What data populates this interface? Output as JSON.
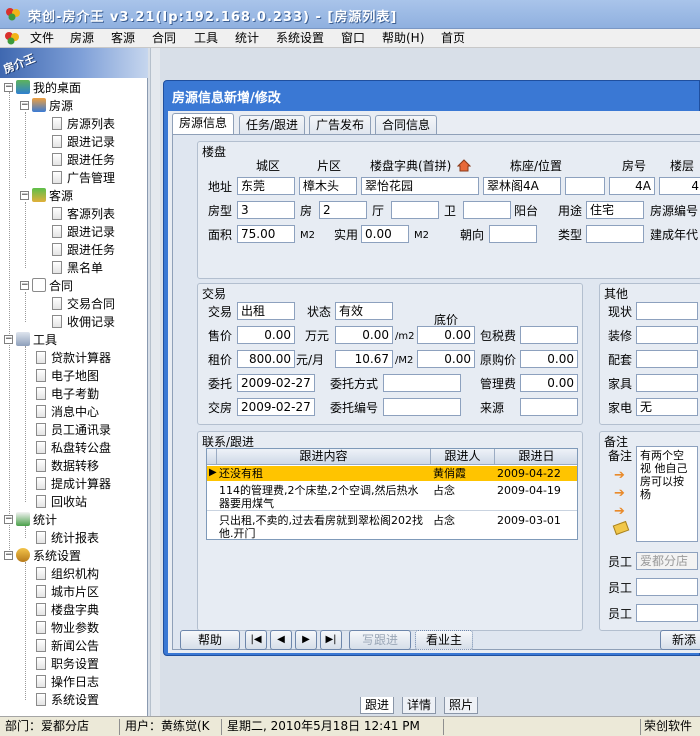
{
  "window": {
    "title": "荣创-房介王 v3.21(Ip:192.168.0.233) - [房源列表]"
  },
  "menu": [
    "文件",
    "房源",
    "客源",
    "合同",
    "工具",
    "统计",
    "系统设置",
    "窗口",
    "帮助(H)",
    "首页"
  ],
  "sidebar": {
    "banner": "房介王",
    "root": "我的桌面",
    "groups": [
      {
        "label": "房源",
        "items": [
          "房源列表",
          "跟进记录",
          "跟进任务",
          "广告管理"
        ]
      },
      {
        "label": "客源",
        "items": [
          "客源列表",
          "跟进记录",
          "跟进任务",
          "黑名单"
        ]
      },
      {
        "label": "合同",
        "items": [
          "交易合同",
          "收佣记录"
        ]
      },
      {
        "label": "工具",
        "items": [
          "贷款计算器",
          "电子地图",
          "电子考勤",
          "消息中心",
          "员工通讯录",
          "私盘转公盘",
          "数据转移",
          "提成计算器",
          "回收站"
        ]
      },
      {
        "label": "统计",
        "items": [
          "统计报表"
        ]
      },
      {
        "label": "系统设置",
        "items": [
          "组织机构",
          "城市片区",
          "楼盘字典",
          "物业参数",
          "新闻公告",
          "职务设置",
          "操作日志",
          "系统设置"
        ]
      }
    ]
  },
  "background_tabs": [
    "跟进",
    "详情",
    "照片"
  ],
  "dialog": {
    "title": "房源信息新增/修改",
    "tabs": [
      "房源信息",
      "任务/跟进",
      "广告发布",
      "合同信息"
    ],
    "estate": {
      "group_title": "楼盘",
      "col_headers": {
        "district": "城区",
        "area": "片区",
        "dict": "楼盘字典(首拼)",
        "building": "栋座/位置",
        "room_no": "房号",
        "floor": "楼层"
      },
      "address_label": "地址",
      "district": "东莞",
      "area": "樟木头",
      "estate_name": "翠怡花园",
      "building": "翠林阁4A",
      "room_no": "4A",
      "floor": "4",
      "layout_label": "房型",
      "rooms": "3",
      "rooms_unit": "房",
      "halls": "2",
      "halls_unit": "厅",
      "baths_unit": "卫",
      "balcony_unit": "阳台",
      "usage_label": "用途",
      "usage": "住宅",
      "house_no_label": "房源编号",
      "size_label": "面积",
      "size": "75.00",
      "size_unit": "M2",
      "actual_label": "实用",
      "actual": "0.00",
      "actual_unit": "M2",
      "orient_label": "朝向",
      "type_label": "类型",
      "year_label": "建成年代"
    },
    "trade": {
      "group_title": "交易",
      "trade_label": "交易",
      "trade": "出租",
      "status_label": "状态",
      "status": "有效",
      "base_price_label": "底价",
      "sale_label": "售价",
      "sale": "0.00",
      "sale_unit": "万元",
      "sale_per": "0.00",
      "sale_per_unit": "/m2",
      "sale_base": "0.00",
      "tax_label": "包税费",
      "rent_label": "租价",
      "rent": "800.00",
      "rent_unit": "元/月",
      "rent_per": "10.67",
      "rent_per_unit": "/M2",
      "rent_base": "0.00",
      "orig_label": "原购价",
      "orig": "0.00",
      "entrust_label": "委托",
      "entrust_date": "2009-02-27",
      "entrust_mode_label": "委托方式",
      "fee_label": "管理费",
      "fee": "0.00",
      "handover_label": "交房",
      "handover_date": "2009-02-27",
      "entrust_no_label": "委托编号",
      "source_label": "来源"
    },
    "other": {
      "group_title": "其他",
      "labels": [
        "现状",
        "装修",
        "配套",
        "家具",
        "家电"
      ],
      "appliance": "无"
    },
    "followup": {
      "group_title": "联系/跟进",
      "headers": [
        "跟进内容",
        "跟进人",
        "跟进日"
      ],
      "rows": [
        {
          "content": "还没有租",
          "person": "黄俏霞",
          "date": "2009-04-22"
        },
        {
          "content": "114的管理费,2个床垫,2个空调,然后热水器要用煤气",
          "person": "占念",
          "date": "2009-04-19"
        },
        {
          "content": "只出租,不卖的,过去看房就到翠松阁202找他.开门",
          "person": "占念",
          "date": "2009-03-01"
        }
      ]
    },
    "remark": {
      "group_title": "备注",
      "label": "备注",
      "text": "有两个空\n视 他自己\n房可以按杨",
      "staff_label": "员工",
      "staff_value": "爱都分店"
    },
    "buttons": {
      "help": "帮助",
      "first": "|◀",
      "prev": "◀",
      "next": "▶",
      "last": "▶|",
      "write": "写跟进",
      "owner": "看业主",
      "new": "新添"
    }
  },
  "status": {
    "dept": "部门：爱都分店",
    "user": "用户：黄练觉(K",
    "datetime": "星期二, 2010年5月18日 12:41 PM",
    "company": "荣创软件"
  }
}
